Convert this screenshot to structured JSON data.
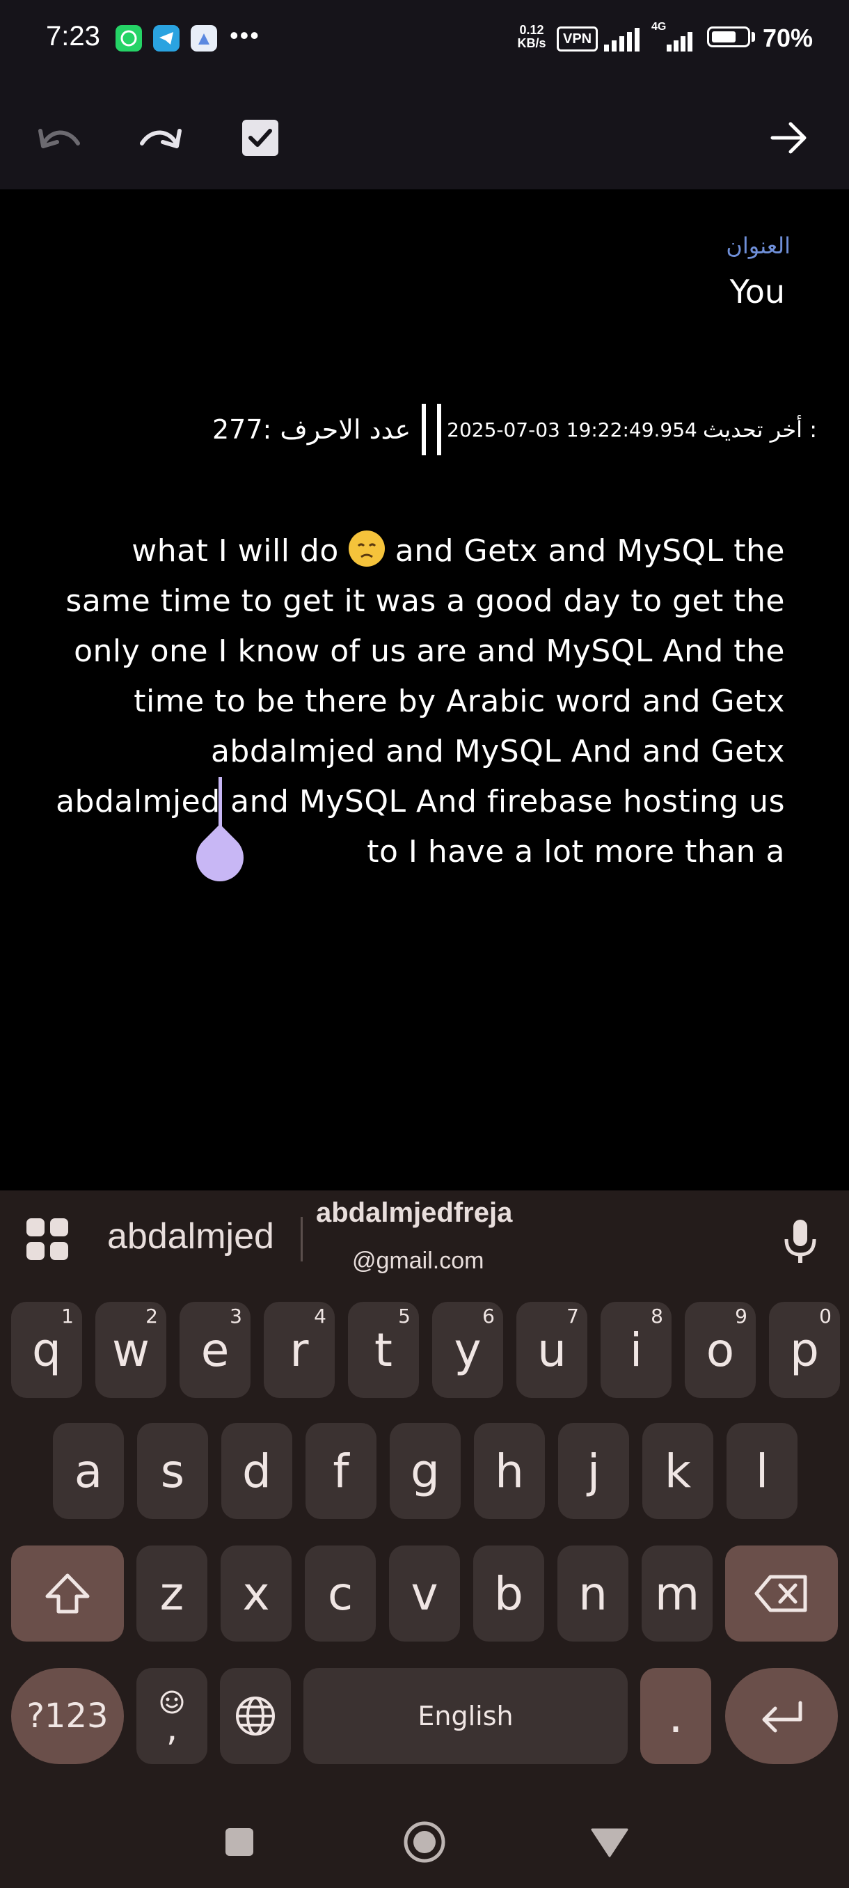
{
  "status_bar": {
    "time": "7:23",
    "apps": [
      {
        "name": "whatsapp-icon",
        "color": "#25d366"
      },
      {
        "name": "telegram-icon",
        "color": "#2aa3e0"
      },
      {
        "name": "app-icon",
        "color": "#5a88e0"
      }
    ],
    "more": "•••",
    "net_speed_value": "0.12",
    "net_speed_unit": "KB/s",
    "vpn": "VPN",
    "network_type": "4G",
    "battery_level": 0.7,
    "battery_percent": "70%"
  },
  "toolbar": {
    "undo": "undo-icon",
    "redo": "redo-icon",
    "done": "checkbox-checked-icon",
    "forward": "arrow-forward-icon"
  },
  "note": {
    "title_label": "العنوان",
    "title_value": "You",
    "char_count": "277:",
    "char_count_label": "عدد الاحرف",
    "last_updated_label": "أخر تحديث :",
    "last_updated_value": "2025-07-03 19:22:49.954",
    "body_lines": [
      {
        "pre": "what I will do ",
        "emoji": true,
        "post": " and Getx and MySQL the"
      },
      {
        "text": "same time to get it was a good day to get the"
      },
      {
        "text": "only one I know of us are and MySQL And the"
      },
      {
        "text": "time to be there by Arabic word and Getx"
      },
      {
        "text": "abdalmjed and MySQL And and Getx"
      },
      {
        "text": "abdalmjed and MySQL And firebase hosting us"
      },
      {
        "text": "to I have a lot more than a"
      }
    ]
  },
  "keyboard": {
    "suggestions": {
      "word1": "abdalmjed",
      "word2": "abdalmjedfreja",
      "word2_sub": "@gmail.com"
    },
    "row1": [
      {
        "k": "q",
        "h": "1"
      },
      {
        "k": "w",
        "h": "2"
      },
      {
        "k": "e",
        "h": "3"
      },
      {
        "k": "r",
        "h": "4"
      },
      {
        "k": "t",
        "h": "5"
      },
      {
        "k": "y",
        "h": "6"
      },
      {
        "k": "u",
        "h": "7"
      },
      {
        "k": "i",
        "h": "8"
      },
      {
        "k": "o",
        "h": "9"
      },
      {
        "k": "p",
        "h": "0"
      }
    ],
    "row2": [
      "a",
      "s",
      "d",
      "f",
      "g",
      "h",
      "j",
      "k",
      "l"
    ],
    "row3": [
      "z",
      "x",
      "c",
      "v",
      "b",
      "n",
      "m"
    ],
    "symbols_key": "?123",
    "comma_key": ",",
    "space_label": "English",
    "period_key": "."
  },
  "colors": {
    "accent": "#c8b7f5",
    "title_label": "#6f8fd8",
    "keyboard_bg": "#241c1b",
    "key_bg": "#3b3231",
    "mod_key_bg": "#6a4f4a"
  }
}
